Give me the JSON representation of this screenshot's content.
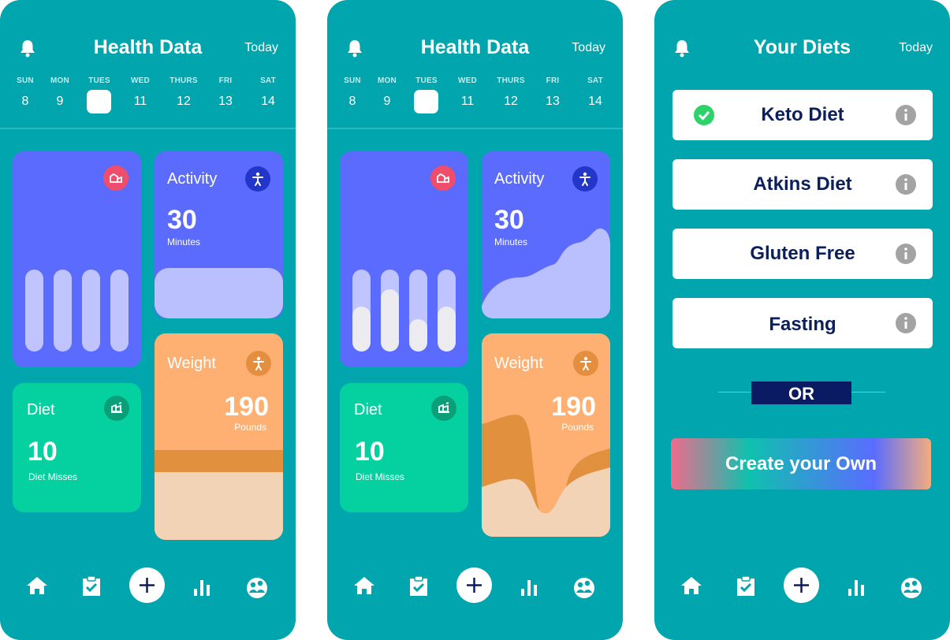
{
  "screen1": {
    "title": "Health Data",
    "today": "Today",
    "days": [
      {
        "name": "SUN",
        "date": "8"
      },
      {
        "name": "MON",
        "date": "9"
      },
      {
        "name": "TUES",
        "date": ""
      },
      {
        "name": "WED",
        "date": "11"
      },
      {
        "name": "THURS",
        "date": "12"
      },
      {
        "name": "FRI",
        "date": "13"
      },
      {
        "name": "SAT",
        "date": "14"
      }
    ],
    "selected_day_index": 2,
    "activity": {
      "label": "Activity",
      "value": "30",
      "unit": "Minutes"
    },
    "diet": {
      "label": "Diet",
      "value": "10",
      "unit": "Diet Misses"
    },
    "weight": {
      "label": "Weight",
      "value": "190",
      "unit": "Pounds"
    },
    "bar_levels": []
  },
  "screen2": {
    "title": "Health Data",
    "today": "Today",
    "days": [
      {
        "name": "SUN",
        "date": "8"
      },
      {
        "name": "MON",
        "date": "9"
      },
      {
        "name": "TUES",
        "date": ""
      },
      {
        "name": "WED",
        "date": "11"
      },
      {
        "name": "THURS",
        "date": "12"
      },
      {
        "name": "FRI",
        "date": "13"
      },
      {
        "name": "SAT",
        "date": "14"
      }
    ],
    "selected_day_index": 2,
    "activity": {
      "label": "Activity",
      "value": "30",
      "unit": "Minutes"
    },
    "diet": {
      "label": "Diet",
      "value": "10",
      "unit": "Diet Misses"
    },
    "weight": {
      "label": "Weight",
      "value": "190",
      "unit": "Pounds"
    },
    "bar_levels": [
      0.55,
      0.76,
      0.39,
      0.55
    ]
  },
  "screen3": {
    "title": "Your Diets",
    "today": "Today",
    "diets": [
      {
        "label": "Keto Diet",
        "selected": true
      },
      {
        "label": "Atkins Diet",
        "selected": false
      },
      {
        "label": "Gluten Free",
        "selected": false
      },
      {
        "label": "Fasting",
        "selected": false
      }
    ],
    "or_label": "OR",
    "create_label": "Create your Own"
  },
  "nav_icons": [
    "home-icon",
    "clipboard-check-icon",
    "plus-icon",
    "bar-chart-icon",
    "profile-icon"
  ],
  "colors": {
    "background": "#00a5ad",
    "card_blue": "#5b6bfd",
    "card_green": "#05d0a0",
    "card_orange": "#fdb072",
    "navy_text": "#0b1f5a",
    "or_box": "#0a1b63"
  }
}
